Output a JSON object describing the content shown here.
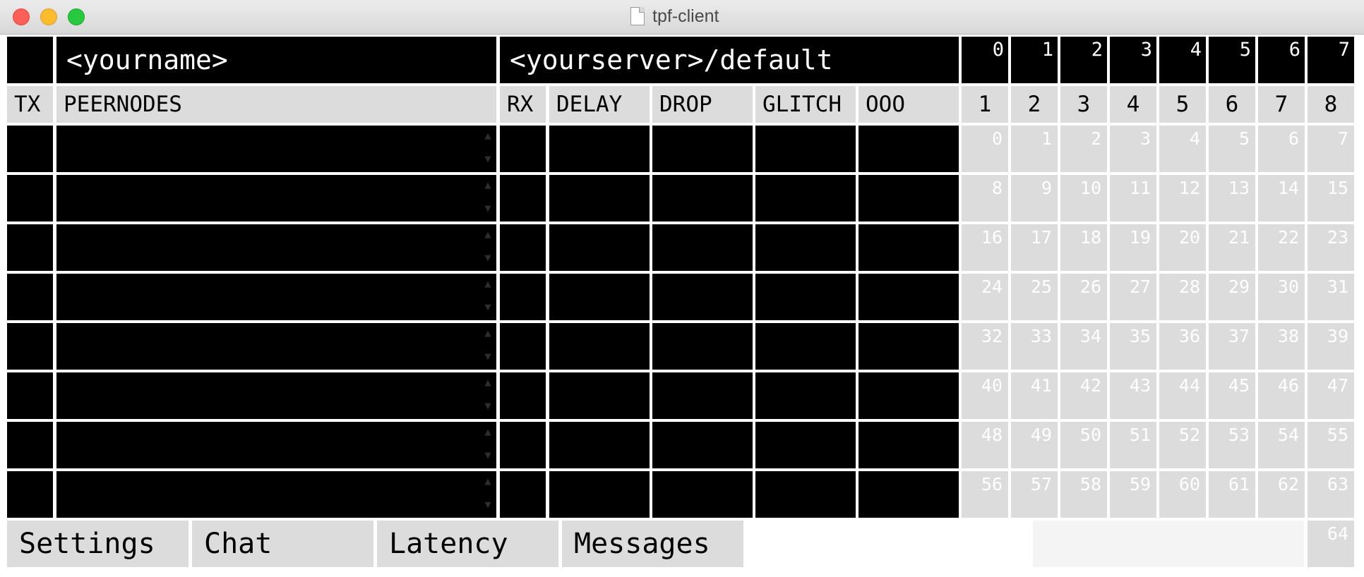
{
  "window": {
    "title": "tpf-client"
  },
  "header": {
    "name": "<yourname>",
    "server": "<yourserver>/default"
  },
  "top_channels": [
    "0",
    "1",
    "2",
    "3",
    "4",
    "5",
    "6",
    "7"
  ],
  "columns": {
    "tx": "TX",
    "peernodes": "PEERNODES",
    "rx": "RX",
    "delay": "DELAY",
    "drop": "DROP",
    "glitch": "GLITCH",
    "ooo": "OOO"
  },
  "channel_numbers": [
    "1",
    "2",
    "3",
    "4",
    "5",
    "6",
    "7",
    "8"
  ],
  "peer_rows": 8,
  "spinner": {
    "up": "▲",
    "down": "▼"
  },
  "grid_numbers": [
    [
      "0",
      "1",
      "2",
      "3",
      "4",
      "5",
      "6",
      "7"
    ],
    [
      "8",
      "9",
      "10",
      "11",
      "12",
      "13",
      "14",
      "15"
    ],
    [
      "16",
      "17",
      "18",
      "19",
      "20",
      "21",
      "22",
      "23"
    ],
    [
      "24",
      "25",
      "26",
      "27",
      "28",
      "29",
      "30",
      "31"
    ],
    [
      "32",
      "33",
      "34",
      "35",
      "36",
      "37",
      "38",
      "39"
    ],
    [
      "40",
      "41",
      "42",
      "43",
      "44",
      "45",
      "46",
      "47"
    ],
    [
      "48",
      "49",
      "50",
      "51",
      "52",
      "53",
      "54",
      "55"
    ],
    [
      "56",
      "57",
      "58",
      "59",
      "60",
      "61",
      "62",
      "63"
    ]
  ],
  "extra_cell": "64",
  "tabs": [
    "Settings",
    "Chat",
    "Latency",
    "Messages"
  ]
}
